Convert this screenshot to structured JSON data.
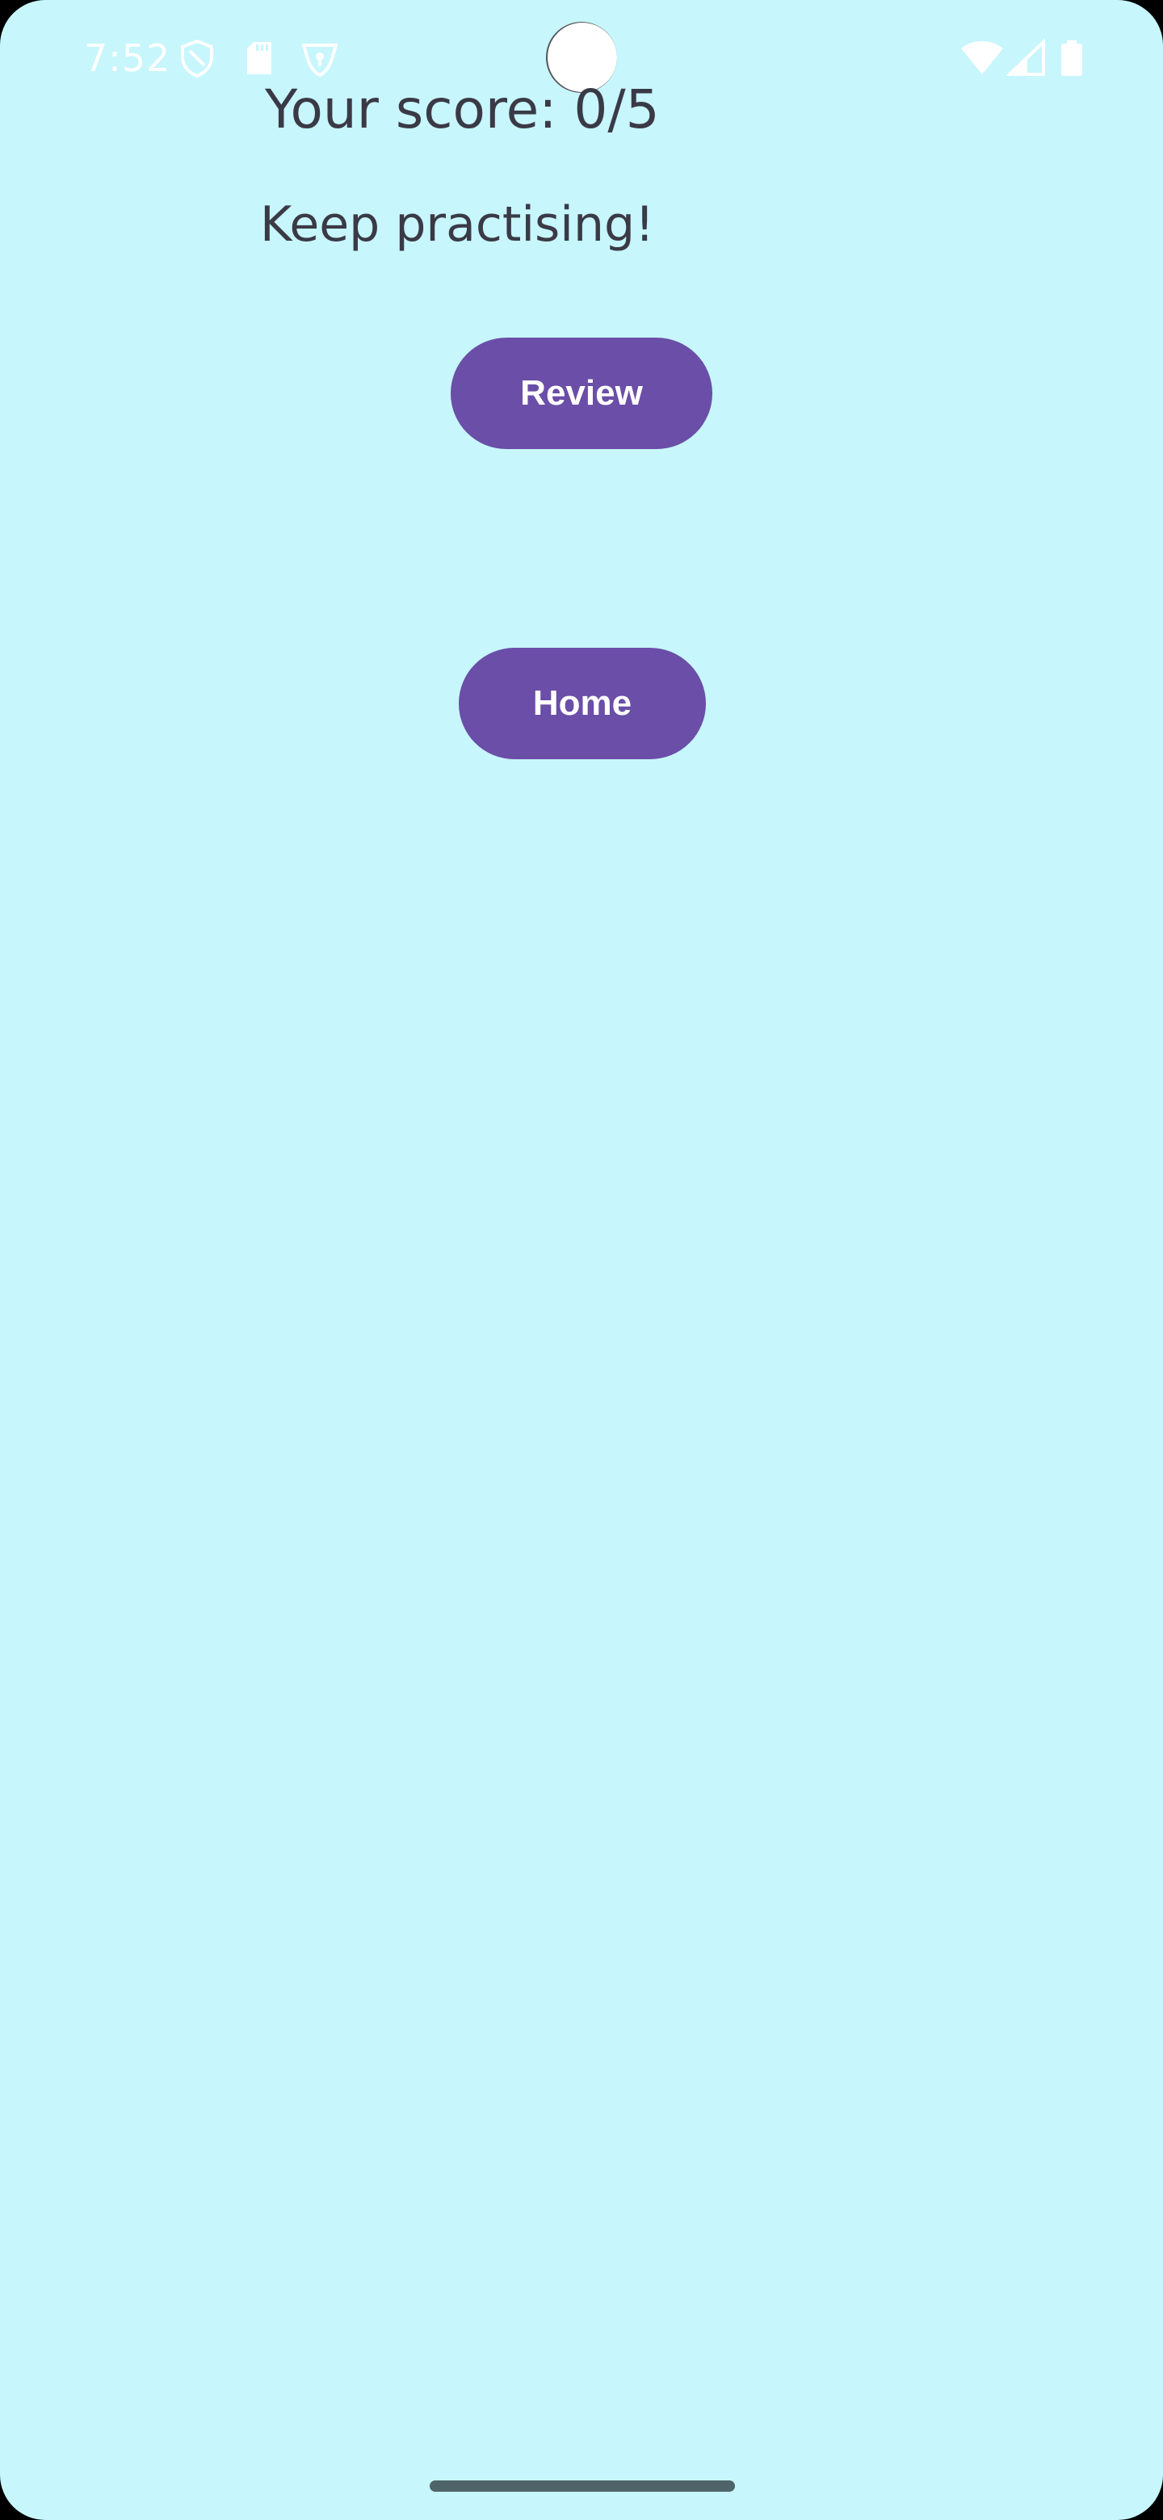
{
  "status_bar": {
    "time": "7:52",
    "left_icons": [
      "shield-icon",
      "sd-card-icon",
      "vpn-shield-icon"
    ],
    "right_icons": [
      "wifi-icon",
      "cell-signal-icon",
      "battery-icon"
    ],
    "icon_color": "#ffffff"
  },
  "result": {
    "score": "Your score: 0/5",
    "message": "Keep practising!"
  },
  "actions": {
    "review_label": "Review",
    "home_label": "Home"
  },
  "colors": {
    "background": "#c7f6fc",
    "button": "#6a4ea7",
    "text": "#3a3a46"
  }
}
